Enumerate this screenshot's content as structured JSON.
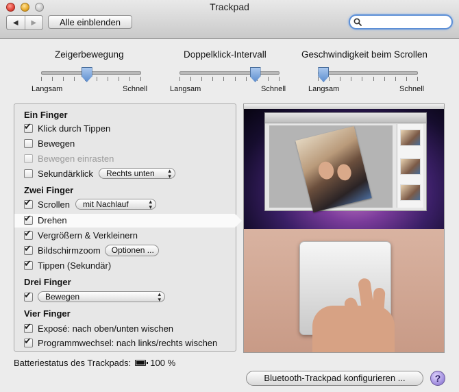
{
  "window": {
    "title": "Trackpad"
  },
  "toolbar": {
    "back_icon": "◀",
    "forward_icon": "▶",
    "show_all_label": "Alle einblenden",
    "search_placeholder": "",
    "search_value": ""
  },
  "sliders": [
    {
      "title": "Zeigerbewegung",
      "min_label": "Langsam",
      "max_label": "Schnell",
      "value_fraction": 0.45,
      "ticks": 10
    },
    {
      "title": "Doppelklick-Intervall",
      "min_label": "Langsam",
      "max_label": "Schnell",
      "value_fraction": 0.75,
      "ticks": 10
    },
    {
      "title": "Geschwindigkeit beim Scrollen",
      "min_label": "Langsam",
      "max_label": "Schnell",
      "value_fraction": 0.05,
      "ticks": 10
    }
  ],
  "sections": {
    "one_finger": {
      "title": "Ein Finger",
      "tap_to_click": {
        "label": "Klick durch Tippen",
        "checked": true
      },
      "dragging": {
        "label": "Bewegen",
        "checked": false
      },
      "drag_lock": {
        "label": "Bewegen einrasten",
        "checked": false,
        "enabled": false
      },
      "secondary_click": {
        "label": "Sekundärklick",
        "checked": false,
        "option": "Rechts unten"
      }
    },
    "two_fingers": {
      "title": "Zwei Finger",
      "scroll": {
        "label": "Scrollen",
        "checked": true,
        "option": "mit Nachlauf"
      },
      "rotate": {
        "label": "Drehen",
        "checked": true
      },
      "pinch": {
        "label": "Vergrößern & Verkleinern",
        "checked": true
      },
      "screen_zoom": {
        "label": "Bildschirmzoom",
        "checked": true,
        "button": "Optionen ..."
      },
      "secondary_tap": {
        "label": "Tippen (Sekundär)",
        "checked": true
      }
    },
    "three_fingers": {
      "title": "Drei Finger",
      "drag": {
        "checked": true,
        "option": "Bewegen"
      }
    },
    "four_fingers": {
      "title": "Vier Finger",
      "expose": {
        "label": "Exposé: nach oben/unten wischen",
        "checked": true
      },
      "app_switch": {
        "label": "Programmwechsel: nach links/rechts wischen",
        "checked": true
      }
    }
  },
  "footer": {
    "battery_label": "Batteriestatus des Trackpads:",
    "battery_value": "100 %",
    "configure_button": "Bluetooth-Trackpad konfigurieren ...",
    "help_button": "?"
  },
  "colors": {
    "accent": "#5c8fd6",
    "slider_thumb": "#6f9ad6",
    "help_button": "#a592e0"
  }
}
